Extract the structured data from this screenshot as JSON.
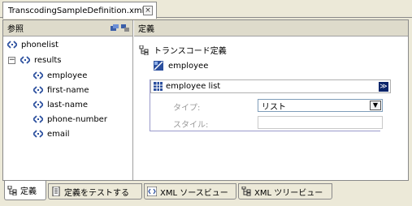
{
  "editor_tab": {
    "title": "TranscodingSampleDefinition.xml*",
    "close": "×"
  },
  "left_pane": {
    "title": "参照",
    "tree": [
      {
        "label": "phonelist"
      },
      {
        "label": "results",
        "expander": "−"
      },
      {
        "label": "employee"
      },
      {
        "label": "first-name"
      },
      {
        "label": "last-name"
      },
      {
        "label": "phone-number"
      },
      {
        "label": "email"
      }
    ]
  },
  "right_pane": {
    "title": "定義",
    "root_label": "トランスコード定義",
    "employee_label": "employee",
    "list_label": "employee list",
    "list_button": "≫",
    "type_label": "タイプ:",
    "type_value": "リスト",
    "style_label": "スタイル:",
    "style_value": ""
  },
  "bottom_tabs": [
    {
      "label": "定義"
    },
    {
      "label": "定義をテストする"
    },
    {
      "label": "XML ソースビュー"
    },
    {
      "label": "XML ツリービュー"
    }
  ],
  "colors": {
    "accent": "#0a246a",
    "background": "#ece9d8"
  }
}
